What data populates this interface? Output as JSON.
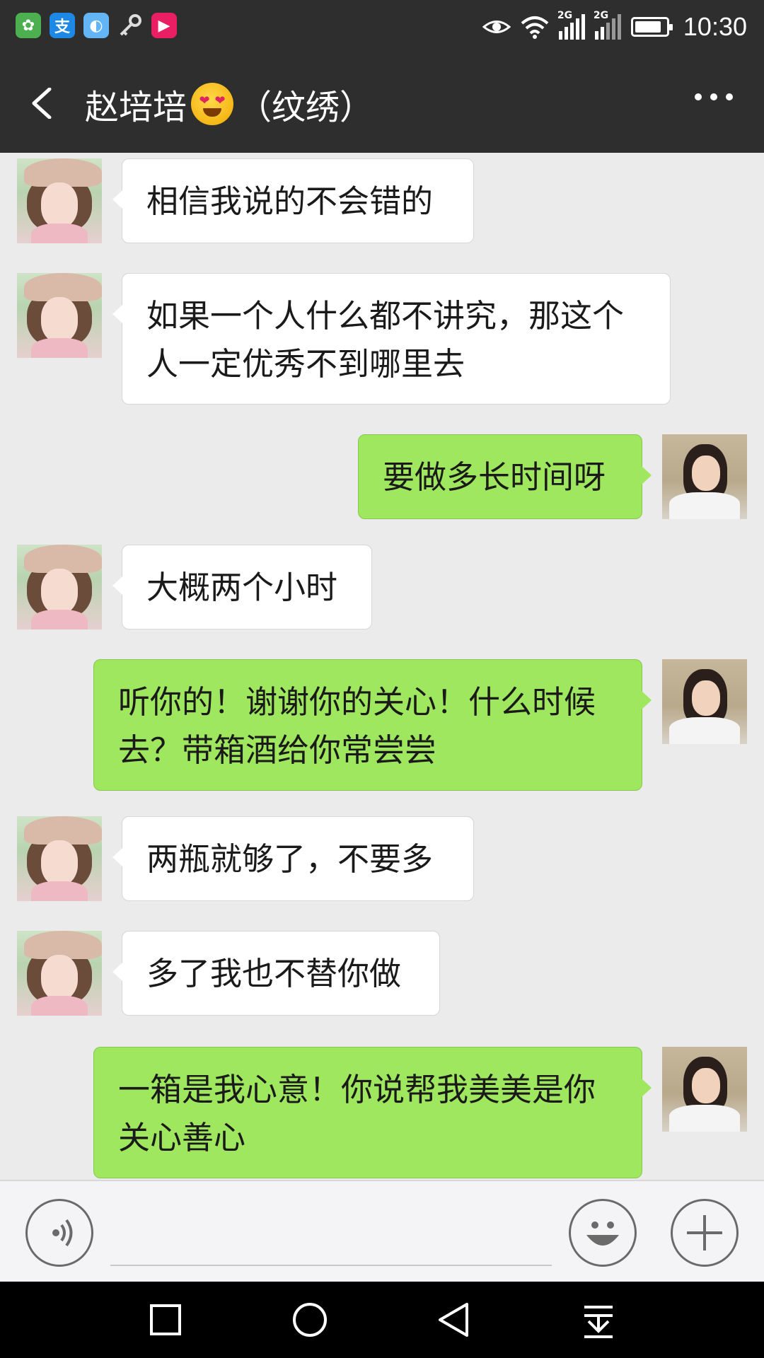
{
  "status_bar": {
    "time": "10:30",
    "network_1": "2G",
    "network_2": "2G",
    "app_icons": [
      "app-icon-green",
      "alipay-icon",
      "app-icon-blue",
      "key-icon",
      "video-app-icon"
    ],
    "battery_level": 0.85
  },
  "header": {
    "contact_name": "赵培培",
    "contact_note": "（纹绣）",
    "emoji": "heart-eyes-emoji"
  },
  "messages": [
    {
      "sender": "contact",
      "lines": [
        "相信我说的不会错的"
      ]
    },
    {
      "sender": "contact",
      "lines": [
        "如果一个人什么都不讲究，那这个",
        "人一定优秀不到哪里去"
      ]
    },
    {
      "sender": "me",
      "lines": [
        "要做多长时间呀"
      ]
    },
    {
      "sender": "contact",
      "lines": [
        "大概两个小时"
      ]
    },
    {
      "sender": "me",
      "lines": [
        "听你的！谢谢你的关心！什么时候",
        "去？带箱酒给你常尝尝"
      ]
    },
    {
      "sender": "contact",
      "lines": [
        "两瓶就够了，不要多"
      ]
    },
    {
      "sender": "contact",
      "lines": [
        "多了我也不替你做"
      ]
    },
    {
      "sender": "me",
      "lines": [
        "一箱是我心意！你说帮我美美是你",
        "关心善心"
      ]
    }
  ],
  "colors": {
    "bar_bg": "#2e2e2e",
    "chat_bg": "#ebebeb",
    "bubble_out": "#9ee75e",
    "bubble_in": "#ffffff"
  },
  "input_bar": {
    "icons": [
      "voice-icon",
      "emoji-icon",
      "plus-icon"
    ]
  },
  "nav_bar": {
    "icons": [
      "recent-apps-icon",
      "home-icon",
      "back-nav-icon",
      "notification-pull-icon"
    ]
  }
}
